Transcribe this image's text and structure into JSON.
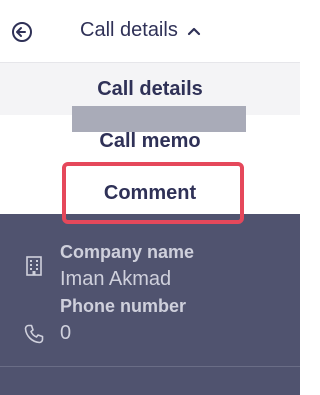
{
  "header": {
    "title": "Call details"
  },
  "menu": {
    "items": [
      {
        "label": "Call details"
      },
      {
        "label": "Call memo"
      },
      {
        "label": "Comment"
      }
    ]
  },
  "details": {
    "company_label": "Company name",
    "company_value": "Iman Akmad",
    "phone_label": "Phone number",
    "phone_value_prefix": "0"
  },
  "colors": {
    "highlight": "#e5485b",
    "overlay": "#50536f"
  },
  "icons": {
    "back": "back-arrow-circle-icon",
    "chevron": "chevron-up-icon",
    "company": "building-icon",
    "phone": "phone-icon"
  }
}
